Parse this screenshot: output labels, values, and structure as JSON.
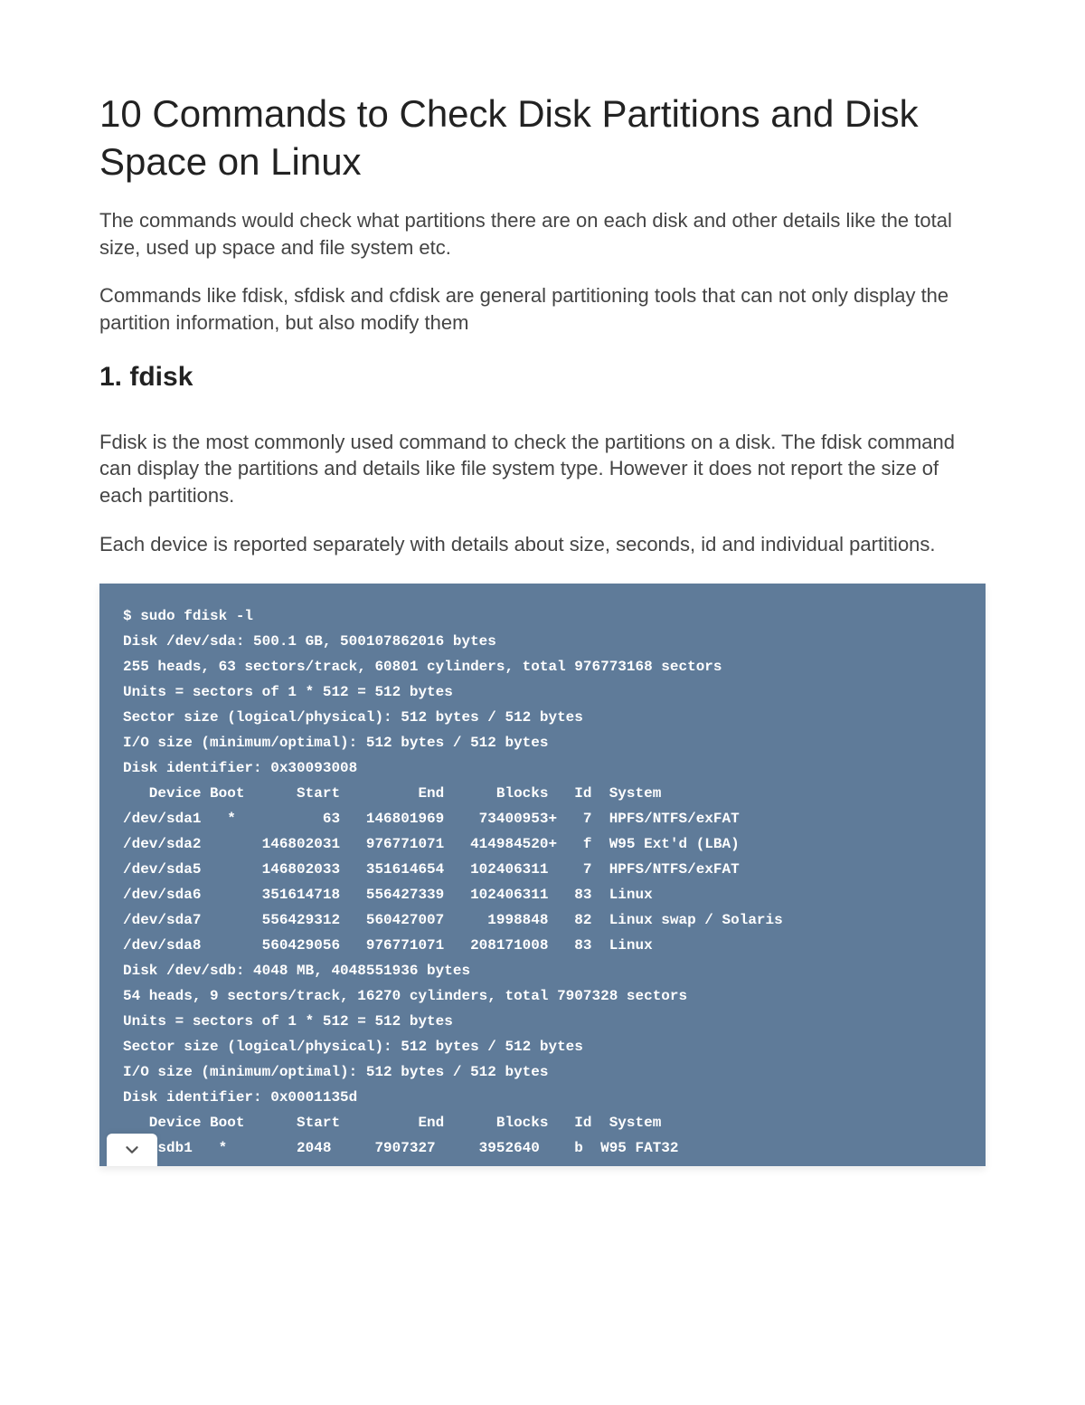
{
  "title": "10 Commands to Check Disk Partitions and Disk Space on Linux",
  "intro1": "The commands would check what partitions there are on each disk and other details like the total size, used up space and file system etc.",
  "intro2": "Commands like fdisk, sfdisk and cfdisk are general partitioning tools that can not only display the partition information, but also modify them",
  "section1": {
    "heading": "1. fdisk",
    "p1": "Fdisk is the most commonly used command to check the partitions on a disk. The fdisk command can display the partitions and details like file system type. However it does not report the size of each partitions.",
    "p2": "Each device is reported separately with details about size, seconds, id and individual partitions.",
    "code": "$ sudo fdisk -l\nDisk /dev/sda: 500.1 GB, 500107862016 bytes\n255 heads, 63 sectors/track, 60801 cylinders, total 976773168 sectors\nUnits = sectors of 1 * 512 = 512 bytes\nSector size (logical/physical): 512 bytes / 512 bytes\nI/O size (minimum/optimal): 512 bytes / 512 bytes\nDisk identifier: 0x30093008\n   Device Boot      Start         End      Blocks   Id  System\n/dev/sda1   *          63   146801969    73400953+   7  HPFS/NTFS/exFAT\n/dev/sda2       146802031   976771071   414984520+   f  W95 Ext'd (LBA)\n/dev/sda5       146802033   351614654   102406311    7  HPFS/NTFS/exFAT\n/dev/sda6       351614718   556427339   102406311   83  Linux\n/dev/sda7       556429312   560427007     1998848   82  Linux swap / Solaris\n/dev/sda8       560429056   976771071   208171008   83  Linux\nDisk /dev/sdb: 4048 MB, 4048551936 bytes\n54 heads, 9 sectors/track, 16270 cylinders, total 7907328 sectors\nUnits = sectors of 1 * 512 = 512 bytes\nSector size (logical/physical): 512 bytes / 512 bytes\nI/O size (minimum/optimal): 512 bytes / 512 bytes\nDisk identifier: 0x0001135d\n   Device Boot      Start         End      Blocks   Id  System\n ev/sdb1   *        2048     7907327     3952640    b  W95 FAT32"
  }
}
